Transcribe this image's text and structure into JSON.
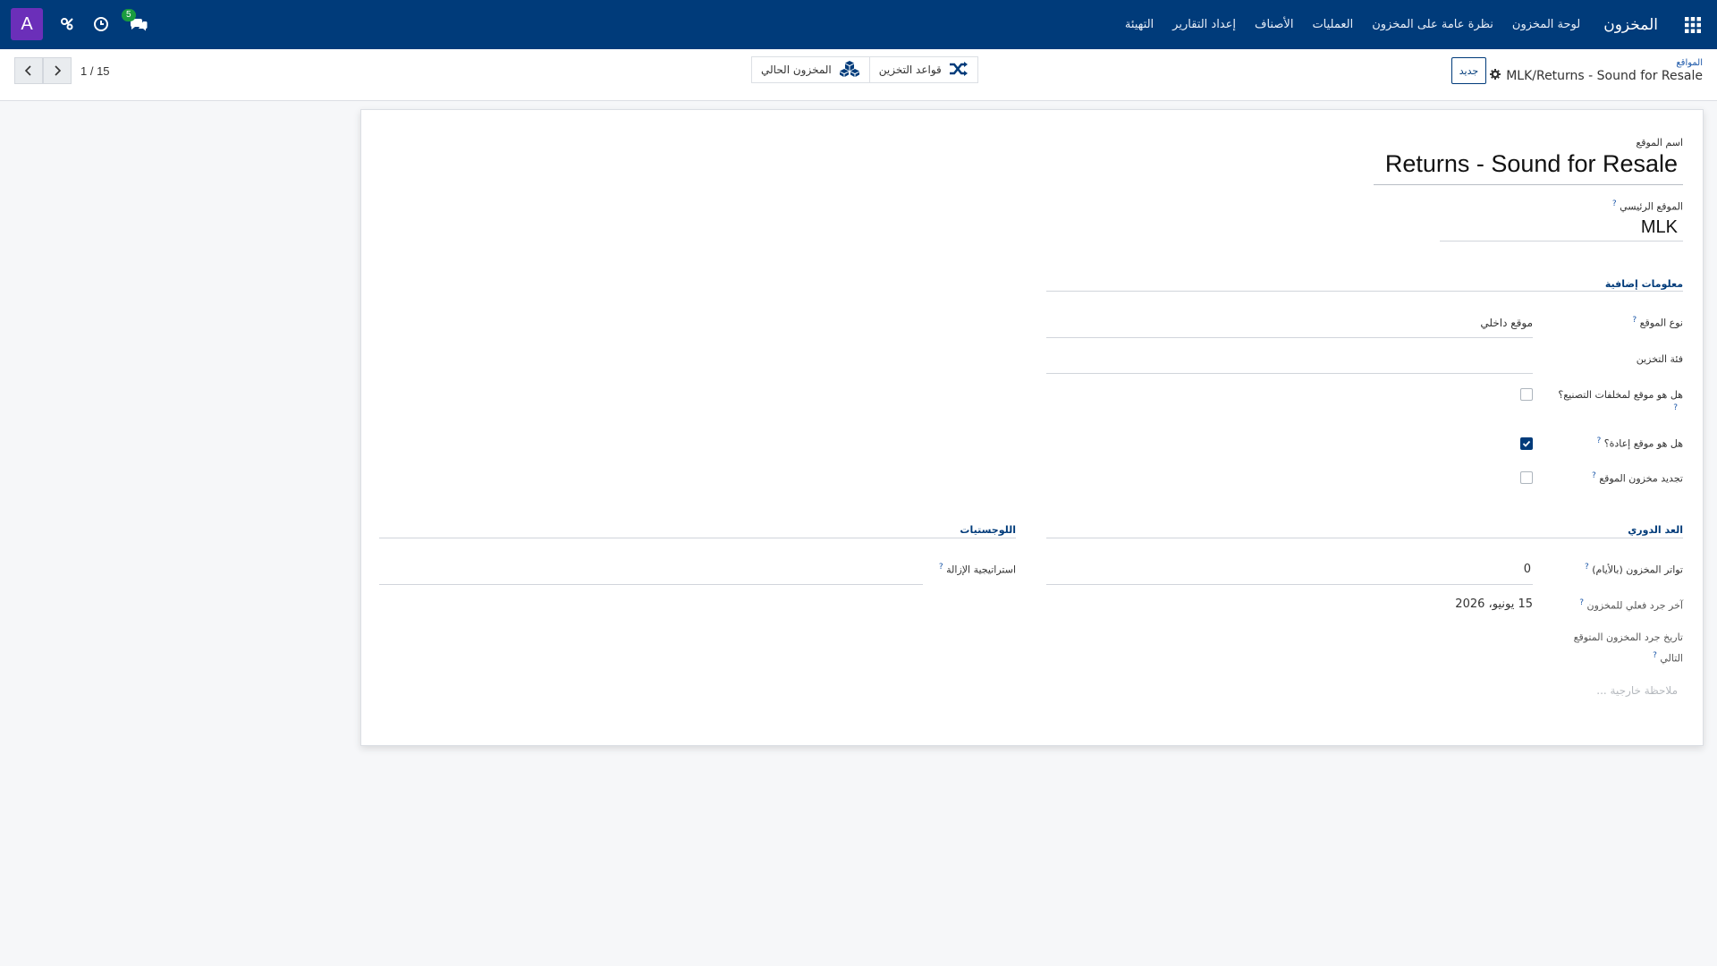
{
  "navbar": {
    "brand": "المخزون",
    "menu": [
      "لوحة المخزون",
      "نظرة عامة على المخزون",
      "العمليات",
      "الأصناف",
      "إعداد التقارير",
      "التهيئة"
    ],
    "avatar_letter": "A",
    "messages_count": "5",
    "bg_color": "#003b7a"
  },
  "control": {
    "new_label": "جديد",
    "breadcrumb_parent": "المواقع",
    "breadcrumb_current": "MLK/Returns - Sound for Resale",
    "smart_buttons": [
      {
        "label": "قواعد التخزين",
        "icon": "shuffle-icon"
      },
      {
        "label": "المخزون الحالي",
        "icon": "cubes-icon"
      }
    ],
    "pager": "1 / 15"
  },
  "form": {
    "location_name_label": "اسم الموقع",
    "location_name_value": "Returns - Sound for Resale",
    "parent_label": "الموقع الرئيسي",
    "parent_value": "MLK",
    "additional_info_title": "معلومات إضافية",
    "location_type_label": "نوع الموقع",
    "location_type_value": "موقع داخلي",
    "storage_category_label": "فئة التخزين",
    "scrap_label": "هل هو موقع لمخلفات التصنيع؟",
    "scrap_checked": false,
    "return_label": "هل هو موقع إعادة؟",
    "return_checked": true,
    "replenish_label": "تجديد مخزون الموقع",
    "replenish_checked": false,
    "cyclic_title": "العد الدوري",
    "frequency_label": "تواتر المخزون (بالأيام)",
    "frequency_value": "0",
    "last_count_label": "آخر جرد فعلي للمخزون",
    "last_count_value": "15 يونيو، 2026",
    "next_count_label_1": "تاريخ جرد المخزون المتوقع",
    "next_count_label_2": "التالي",
    "logistics_title": "اللوجستيات",
    "removal_label": "استراتيجية الإزالة",
    "note_placeholder": "ملاحظة خارجية ..."
  }
}
